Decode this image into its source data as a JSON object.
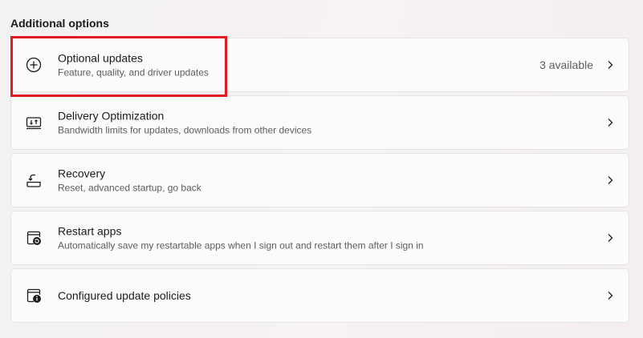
{
  "section": {
    "title": "Additional options"
  },
  "items": [
    {
      "title": "Optional updates",
      "subtitle": "Feature, quality, and driver updates",
      "status": "3 available",
      "icon": "plus-circle-icon"
    },
    {
      "title": "Delivery Optimization",
      "subtitle": "Bandwidth limits for updates, downloads from other devices",
      "icon": "delivery-optimization-icon"
    },
    {
      "title": "Recovery",
      "subtitle": "Reset, advanced startup, go back",
      "icon": "recovery-icon"
    },
    {
      "title": "Restart apps",
      "subtitle": "Automatically save my restartable apps when I sign out and restart them after I sign in",
      "icon": "restart-apps-icon"
    },
    {
      "title": "Configured update policies",
      "icon": "policy-info-icon"
    }
  ],
  "highlight": {
    "color": "#e01b24",
    "target": "Optional updates"
  }
}
